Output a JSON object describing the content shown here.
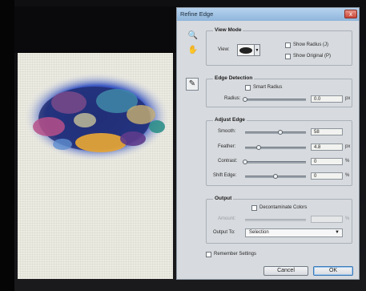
{
  "dialog": {
    "title": "Refine Edge",
    "close_label": "x"
  },
  "tools": {
    "zoom_icon": "magnifier",
    "hand_icon": "hand",
    "brush_icon": "refine-radius-brush"
  },
  "view_mode": {
    "legend": "View Mode",
    "view_label": "View:",
    "show_radius_label": "Show Radius (J)",
    "show_original_label": "Show Original (P)",
    "show_radius_checked": false,
    "show_original_checked": false
  },
  "edge_detection": {
    "legend": "Edge Detection",
    "smart_radius_label": "Smart Radius",
    "smart_radius_checked": false,
    "radius_label": "Radius:",
    "radius_value": "0.0",
    "radius_unit": "px",
    "radius_fraction": 0.0
  },
  "adjust_edge": {
    "legend": "Adjust Edge",
    "smooth_label": "Smooth:",
    "smooth_value": "58",
    "smooth_fraction": 0.58,
    "feather_label": "Feather:",
    "feather_value": "4.8",
    "feather_unit": "px",
    "feather_fraction": 0.22,
    "contrast_label": "Contrast:",
    "contrast_value": "0",
    "contrast_unit": "%",
    "contrast_fraction": 0.0,
    "shift_edge_label": "Shift Edge:",
    "shift_edge_value": "0",
    "shift_edge_unit": "%",
    "shift_edge_fraction": 0.5
  },
  "output": {
    "legend": "Output",
    "decontaminate_label": "Decontaminate Colors",
    "decontaminate_checked": false,
    "amount_label": "Amount:",
    "amount_unit": "%",
    "output_to_label": "Output To:",
    "output_to_value": "Selection"
  },
  "remember_settings_label": "Remember Settings",
  "remember_settings_checked": false,
  "cancel_label": "Cancel",
  "ok_label": "OK",
  "colors": {
    "dialog_bg": "#d7dade",
    "titlebar": "#9fc2e5",
    "close_button": "#c9483a",
    "ok_focus": "#3b78b5"
  }
}
